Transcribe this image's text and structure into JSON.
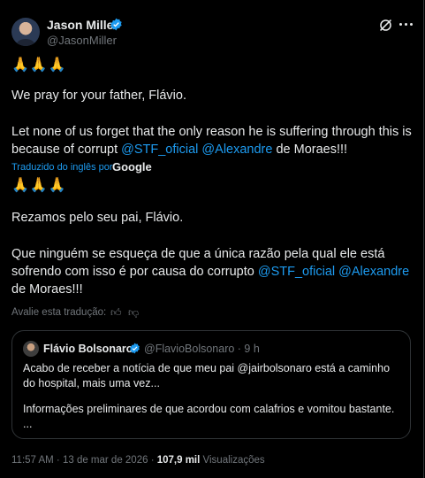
{
  "author": {
    "name": "Jason Miller",
    "handle": "@JasonMiller"
  },
  "post": {
    "emoji1": "🙏🙏🙏",
    "line1": "We pray for your father, Flávio.",
    "line2_pre": "Let none of us forget that the only reason he is suffering through this is because of corrupt ",
    "line2_m1": "@STF_oficial",
    "line2_m2": "@Alexandre",
    "line2_post": " de Moraes!!!",
    "translated_label": "Traduzido do inglês por",
    "translated_by": "Google",
    "emoji2": "🙏🙏🙏",
    "tr_line1": "Rezamos pelo seu pai, Flávio.",
    "tr_line2_pre": "Que ninguém se esqueça de que a única razão pela qual ele está sofrendo com isso é por causa do corrupto ",
    "tr_line2_m1": "@STF_oficial",
    "tr_line2_m2": "@Alexandre",
    "tr_line2_post": " de Moraes!!!",
    "rate_label": "Avalie esta tradução:"
  },
  "quote": {
    "name": "Flávio Bolsonaro",
    "handle_time": "@FlavioBolsonaro · 9 h",
    "line1": "Acabo de receber a notícia de que meu pai @jairbolsonaro está a caminho do hospital, mais uma vez...",
    "line2": "Informações preliminares de que acordou com calafrios e vomitou bastante.",
    "line3": "..."
  },
  "meta": {
    "time": "11:57 AM · 13 de mar de 2026 ·",
    "views_count": "107,9 mil",
    "views_label": "Visualizações"
  },
  "colors": {
    "accent": "#1d9bf0",
    "background": "#000000",
    "muted": "#71767b"
  }
}
